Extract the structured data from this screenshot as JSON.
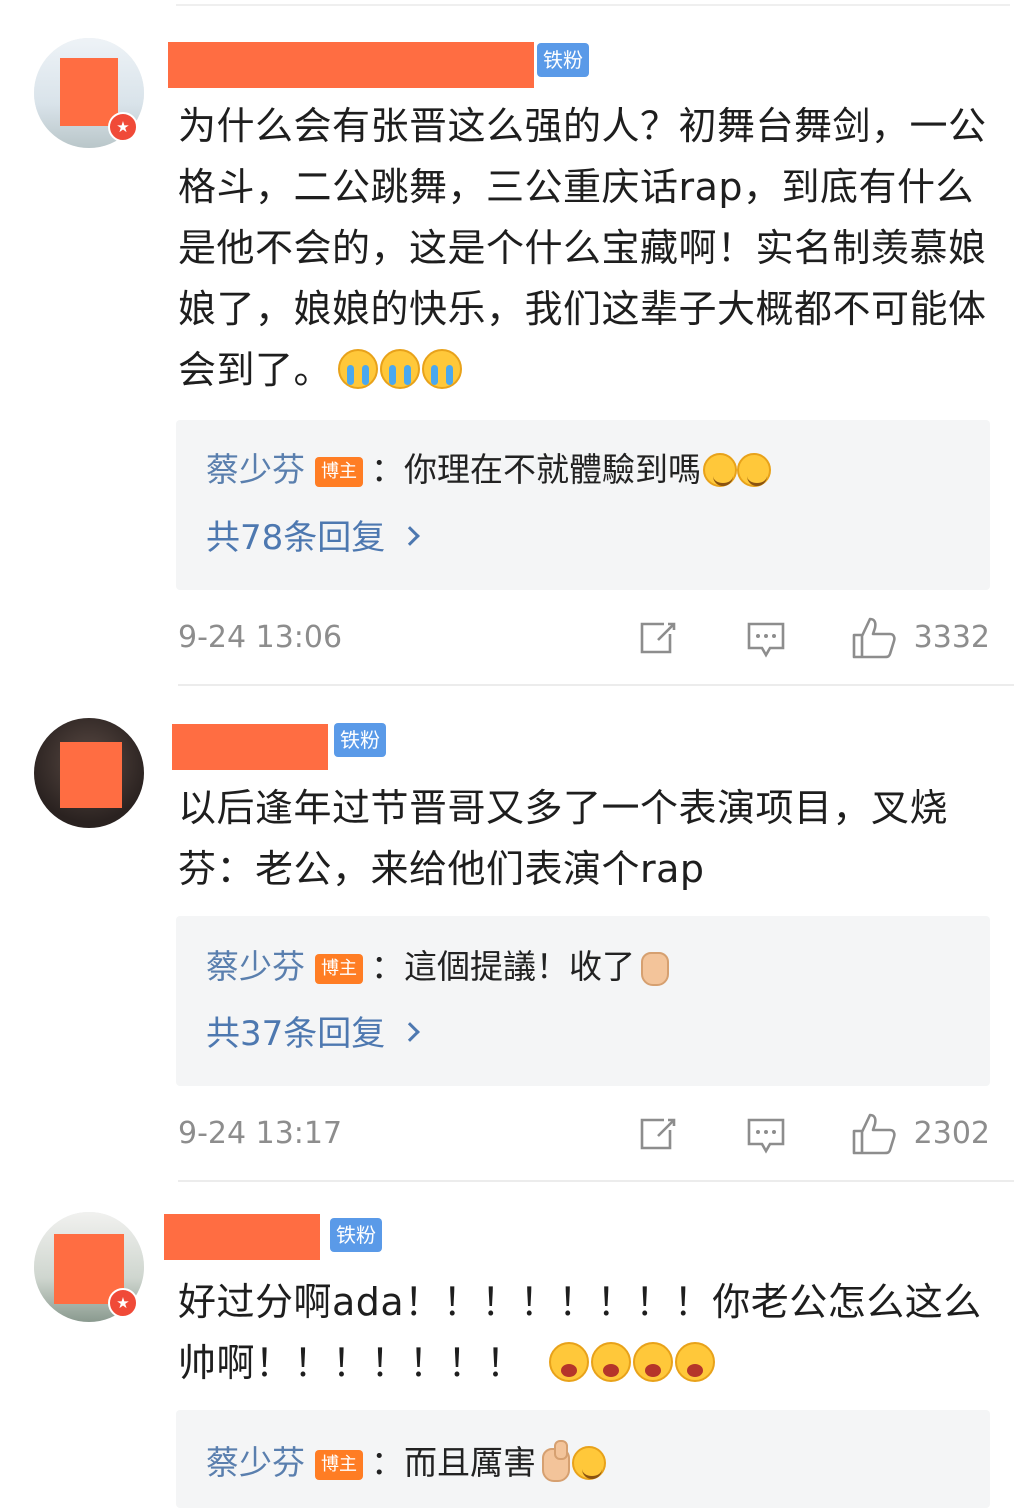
{
  "comments": [
    {
      "badge": "铁粉",
      "text": "为什么会有张晋这么强的人？初舞台舞剑，一公格斗，二公跳舞，三公重庆话rap，到底有什么是他不会的，这是个什么宝藏啊！实名制羡慕娘娘了，娘娘的快乐，我们这辈子大概都不可能体会到了。",
      "reply": {
        "author": "蔡少芬",
        "author_badge": "博主",
        "text": "：你理在不就體驗到嗎",
        "count_label": "共78条回复"
      },
      "time": "9-24 13:06",
      "likes": "3332"
    },
    {
      "badge": "铁粉",
      "text": "以后逢年过节晋哥又多了一个表演项目，叉烧芬：老公，来给他们表演个rap",
      "reply": {
        "author": "蔡少芬",
        "author_badge": "博主",
        "text": "：這個提議！收了",
        "count_label": "共37条回复"
      },
      "time": "9-24 13:17",
      "likes": "2302"
    },
    {
      "badge": "铁粉",
      "text": "好过分啊ada！！！！！！！！你老公怎么这么帅啊！！！！！！！",
      "reply": {
        "author": "蔡少芬",
        "author_badge": "博主",
        "text": "：而且厲害"
      }
    }
  ],
  "icons": {
    "share": "share-icon",
    "comment": "comment-icon",
    "like": "thumbs-up-icon"
  },
  "colors": {
    "name_mask": "#ff6d42",
    "fan_badge": "#5a9ae8",
    "host_badge": "#ff7d24",
    "reply_author": "#5a7fae",
    "reply_count": "#4d78b0"
  }
}
